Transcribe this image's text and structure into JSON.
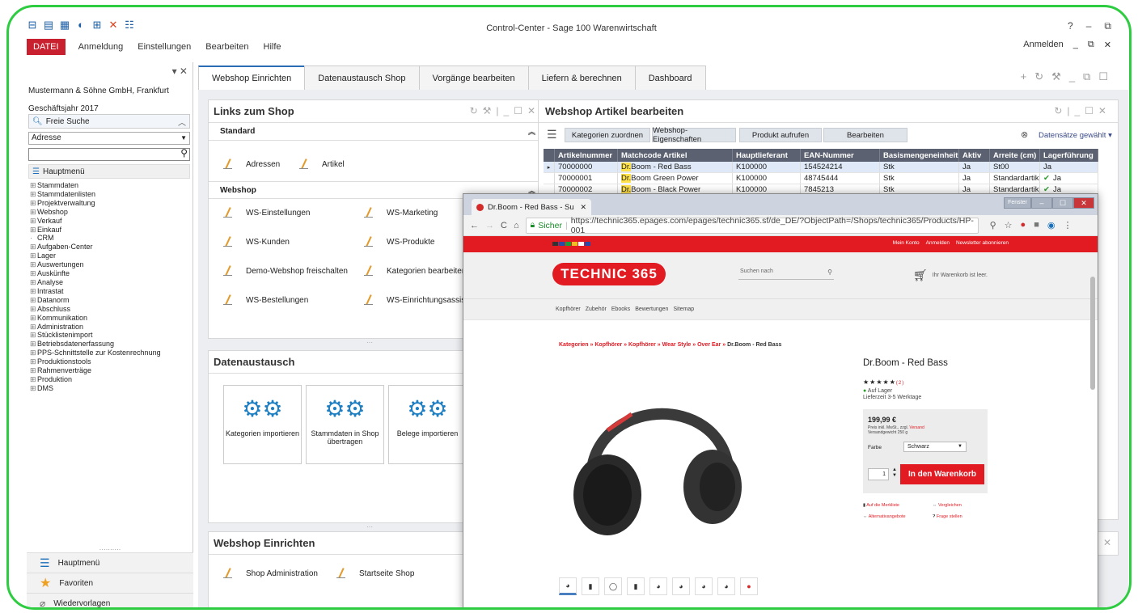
{
  "app": {
    "title": "Control-Center - Sage 100 Warenwirtschaft",
    "help": "?",
    "signin": "Anmelden",
    "menu": [
      "DATEI",
      "Anmeldung",
      "Einstellungen",
      "Bearbeiten",
      "Hilfe"
    ]
  },
  "left": {
    "company": "Mustermann & Söhne GmbH, Frankfurt",
    "fiscal_year": "Geschäftsjahr 2017",
    "free_search": "Freie Suche",
    "search_field": "Adresse",
    "tree_root": "Hauptmenü",
    "tree": [
      "Stammdaten",
      "Stammdatenlisten",
      "Projektverwaltung",
      "Webshop",
      "Verkauf",
      "Einkauf",
      "CRM",
      "Aufgaben-Center",
      "Lager",
      "Auswertungen",
      "Auskünfte",
      "Analyse",
      "Intrastat",
      "Datanorm",
      "Abschluss",
      "Kommunikation",
      "Administration",
      "Stücklistenimport",
      "Betriebsdatenerfassung",
      "PPS-Schnittstelle zur Kostenrechnung",
      "Produktionstools",
      "Rahmenverträge",
      "Produktion",
      "DMS"
    ],
    "bottom": [
      "Hauptmenü",
      "Favoriten",
      "Wiedervorlagen"
    ]
  },
  "tabs": [
    "Webshop Einrichten",
    "Datenaustausch Shop",
    "Vorgänge bearbeiten",
    "Liefern & berechnen",
    "Dashboard"
  ],
  "links_panel": {
    "title": "Links zum Shop",
    "standard": "Standard",
    "standard_links": [
      "Adressen",
      "Artikel"
    ],
    "webshop": "Webshop",
    "webshop_links": [
      "WS-Einstellungen",
      "WS-Marketing",
      "WS-Kunden",
      "WS-Produkte",
      "Demo-Webshop freischalten",
      "Kategorien bearbeiten",
      "WS-Bestellungen",
      "WS-Einrichtungsassisten"
    ]
  },
  "exchange_panel": {
    "title": "Datenaustausch",
    "tiles": [
      "Kategorien importieren",
      "Stammdaten in Shop übertragen",
      "Belege importieren"
    ]
  },
  "setup_panel": {
    "title": "Webshop Einrichten",
    "links": [
      "Shop Administration",
      "Startseite Shop"
    ]
  },
  "articles_panel": {
    "title": "Webshop Artikel bearbeiten",
    "buttons": [
      "Kategorien zuordnen",
      "Webshop-Eigenschaften",
      "Produkt aufrufen",
      "Bearbeiten"
    ],
    "selection": "Datensätze gewählt",
    "columns": [
      "Artikelnummer",
      "Matchcode Artikel",
      "Hauptlieferant",
      "EAN-Nummer",
      "Basismengeneinheit",
      "Aktiv",
      "Arreite (cm)",
      "Lagerführung"
    ],
    "rows": [
      {
        "nr": "70000000",
        "prefix": "Dr.",
        "match": " Boom - Red Bass",
        "lief": "K100000",
        "ean": "154524214",
        "einheit": "Stk",
        "aktiv": "Ja",
        "arreite": "St00",
        "lager": "Ja"
      },
      {
        "nr": "70000001",
        "prefix": "Dr.",
        "match": " Boom Green Power",
        "lief": "K100000",
        "ean": "48745444",
        "einheit": "Stk",
        "aktiv": "Ja",
        "arreite": "Standardartikel",
        "lager": "Ja"
      },
      {
        "nr": "70000002",
        "prefix": "Dr.",
        "match": " Boom - Black Power",
        "lief": "K100000",
        "ean": "7845213",
        "einheit": "Stk",
        "aktiv": "Ja",
        "arreite": "Standardartikel",
        "lager": "Ja"
      }
    ]
  },
  "browser": {
    "tab_title": "Dr.Boom - Red Bass - Su",
    "secure": "Sicher",
    "url": "https://technic365.epages.com/epages/technic365.sf/de_DE/?ObjectPath=/Shops/technic365/Products/HP-001",
    "win_label": "Fenster",
    "top_links": [
      "Mein Konto",
      "Anmelden",
      "Newsletter abonnieren"
    ],
    "logo": "TECHNIC 365",
    "search_placeholder": "Suchen nach",
    "cart_text": "Ihr Warenkorb ist leer.",
    "nav": [
      "Kopfhörer",
      "Zubehör",
      "Ebooks",
      "Bewertungen",
      "Sitemap"
    ],
    "breadcrumb": [
      "Kategorien",
      "Kopfhörer",
      "Kopfhörer",
      "Wear Style",
      "Over Ear"
    ],
    "breadcrumb_last": "Dr.Boom - Red Bass",
    "product_title": "Dr.Boom - Red Bass",
    "stars": "★★★★★",
    "rating_count": "(2)",
    "availability": "Auf Lager",
    "delivery": "Lieferzeit 3-5 Werktage",
    "price": "199,99 €",
    "price_info": "Preis inkl. MwSt., zzgl.",
    "shipping": "Versand",
    "weight": "Versandgewicht 250 g",
    "color_label": "Farbe",
    "color_value": "Schwarz",
    "quantity": "1",
    "buy_button": "In den Warenkorb",
    "extras": [
      "Auf die Merkliste",
      "Vergleichen",
      "Alternativangebote",
      "Frage stellen"
    ]
  }
}
